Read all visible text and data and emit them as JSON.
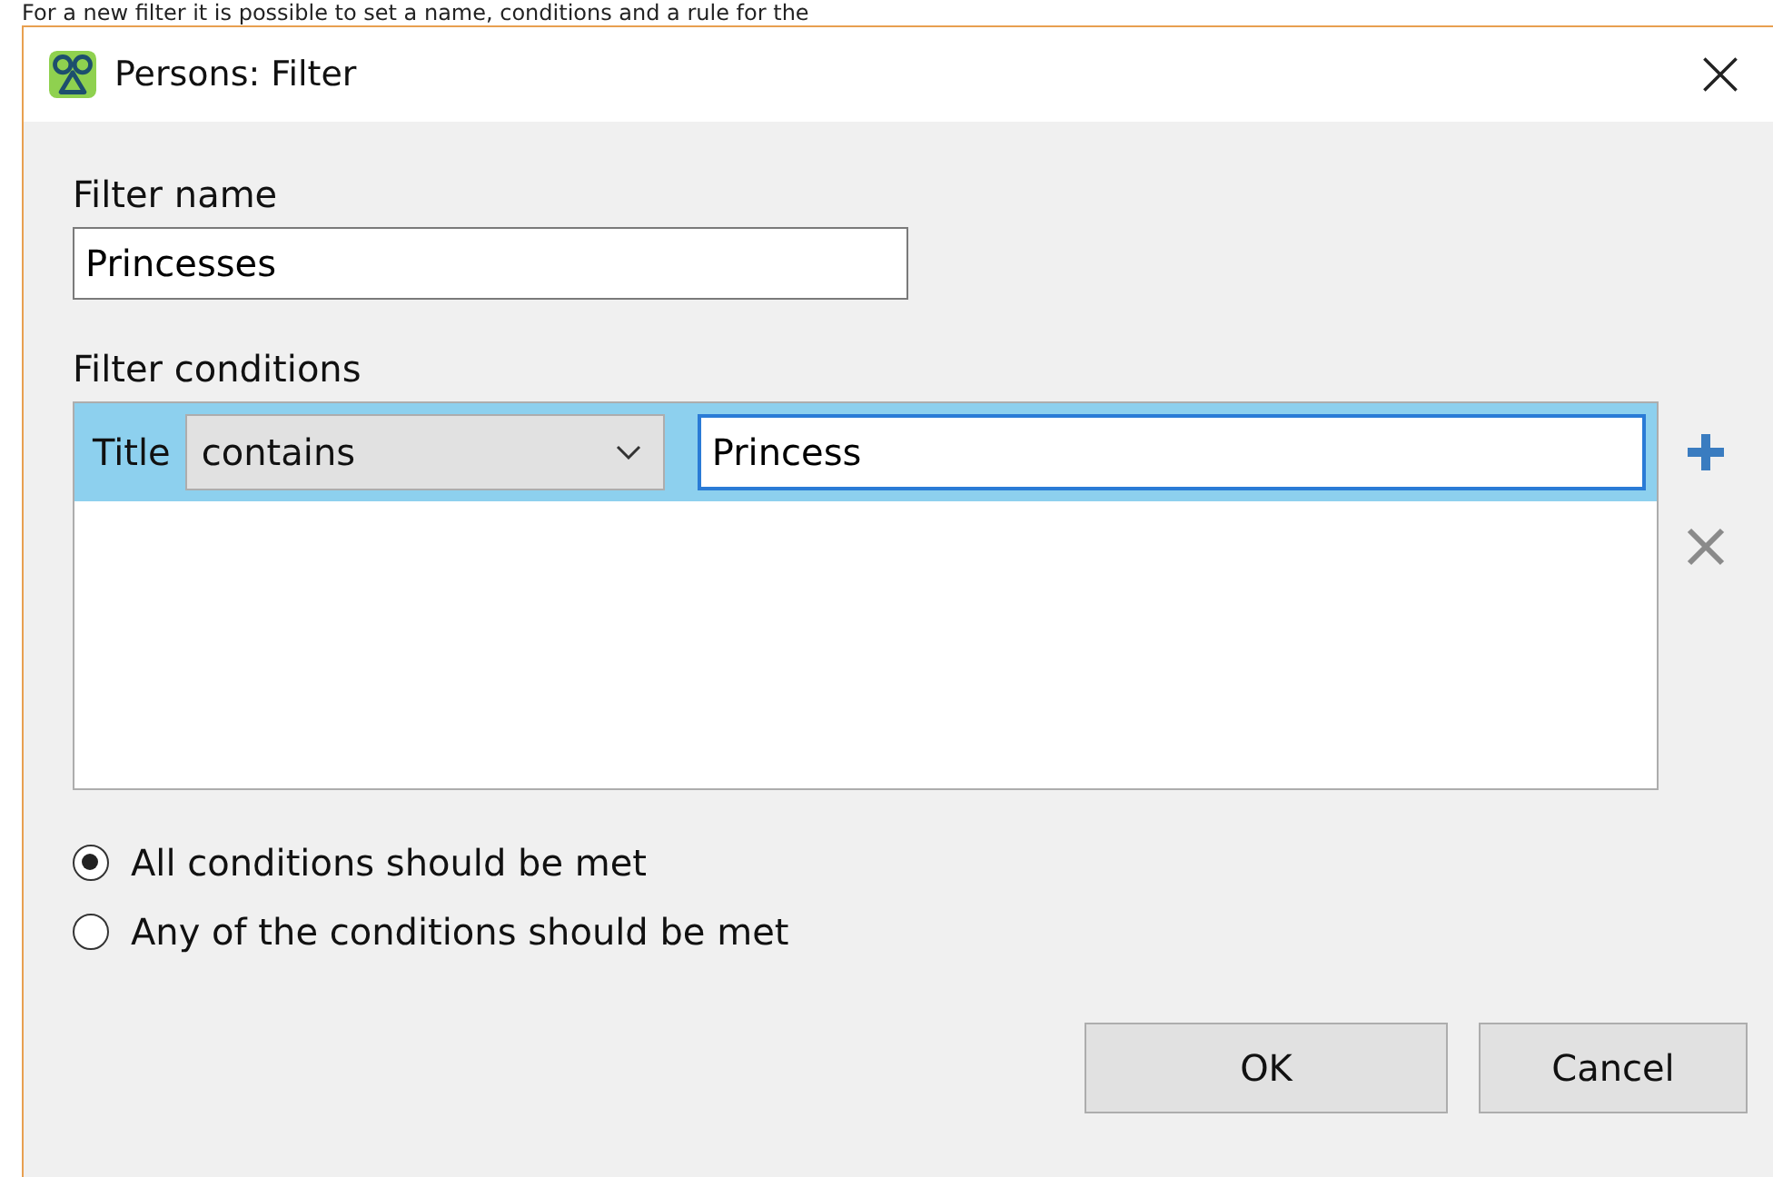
{
  "caption": "For a new filter it is possible to set a name, conditions and a rule for the",
  "window": {
    "title": "Persons: Filter"
  },
  "filter_name": {
    "label": "Filter name",
    "value": "Princesses"
  },
  "filter_conditions": {
    "label": "Filter conditions",
    "rows": [
      {
        "field": "Title",
        "operator": "contains",
        "value": "Princess",
        "selected": true
      }
    ]
  },
  "match_rules": [
    {
      "label": "All conditions should be met",
      "selected": true
    },
    {
      "label": "Any of the conditions should be met",
      "selected": false
    }
  ],
  "buttons": [
    "OK",
    "Cancel"
  ]
}
